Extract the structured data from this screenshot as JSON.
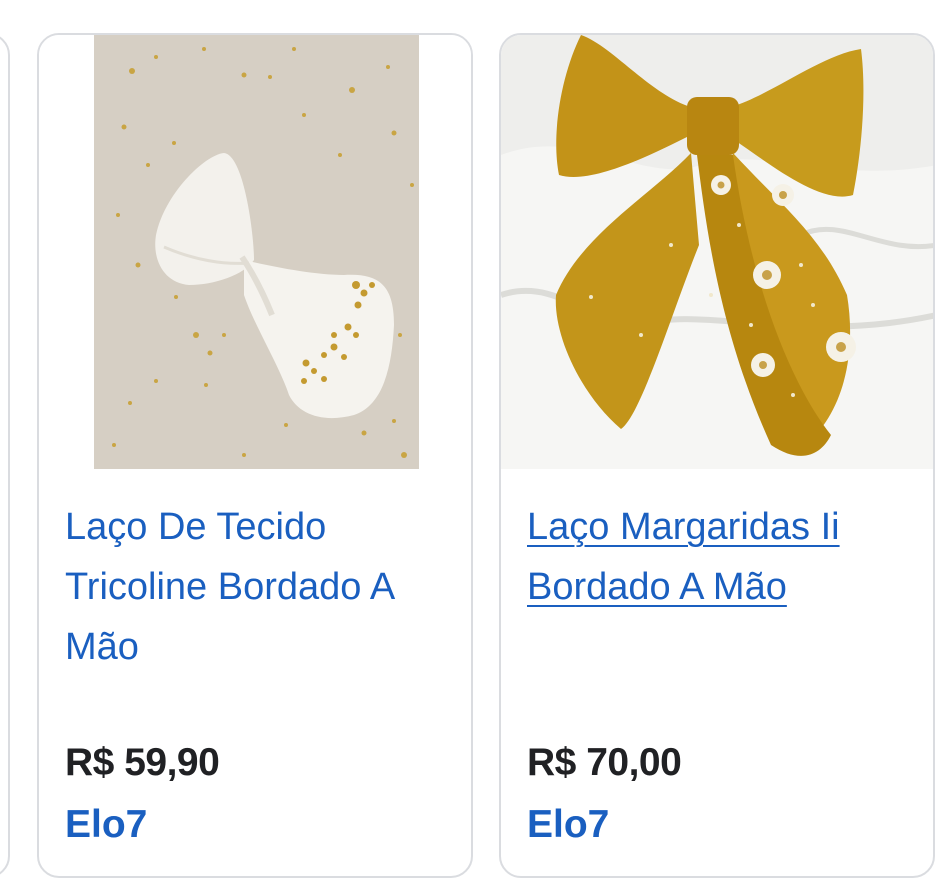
{
  "products": [
    {
      "title": "Laço De Tecido Tricoline Bordado A Mão",
      "price": "R$ 59,90",
      "source": "Elo7",
      "image": "white-embroidered-bow-photo"
    },
    {
      "title": "Laço Margaridas Ii Bordado A Mão",
      "price": "R$ 70,00",
      "source": "Elo7",
      "image": "mustard-daisy-bow-photo"
    }
  ],
  "colors": {
    "link": "#1a5fc0",
    "price": "#202124",
    "card_border": "#dadce0"
  }
}
